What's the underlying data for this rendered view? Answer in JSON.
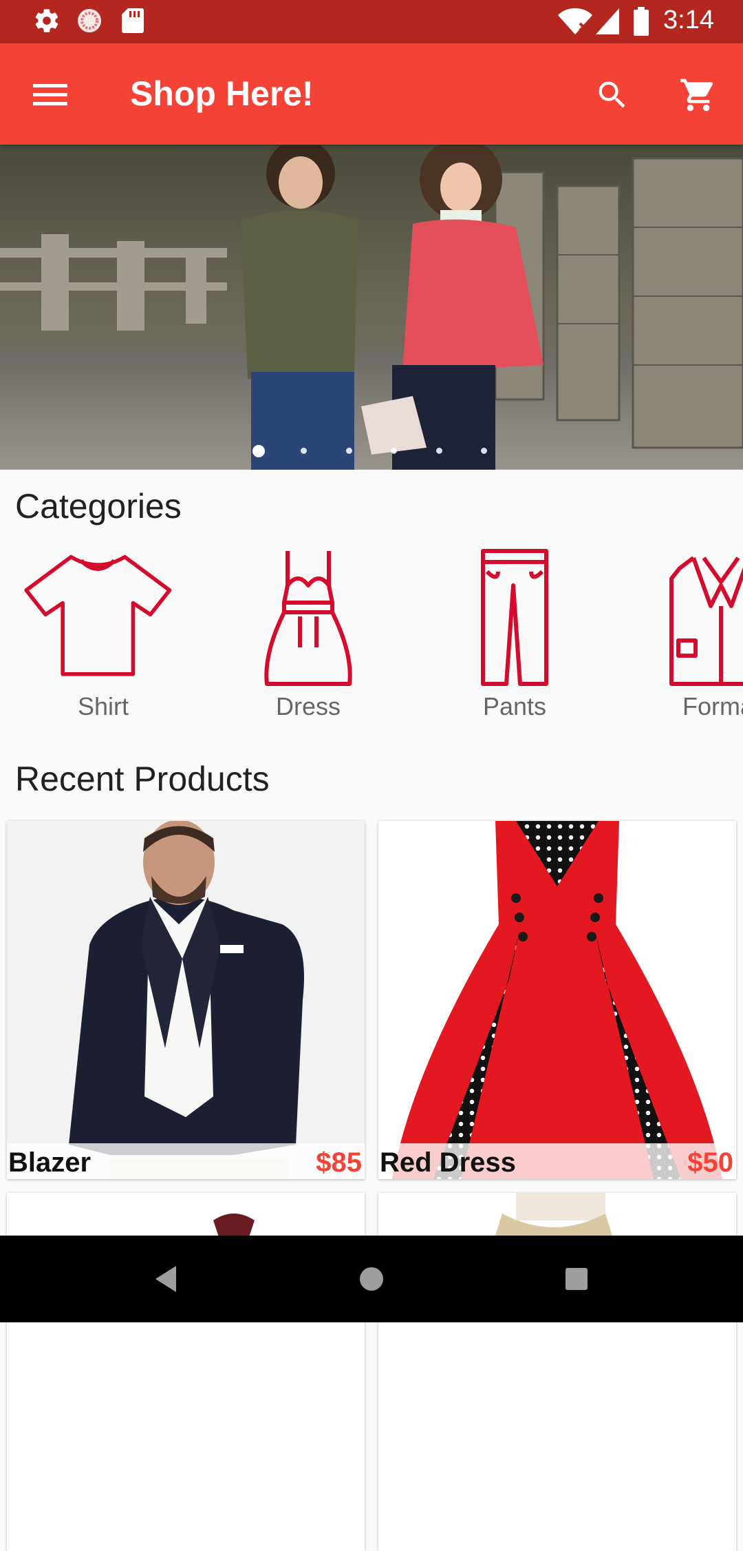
{
  "status_bar": {
    "time": "3:14",
    "icons": [
      "settings-icon",
      "sync-icon",
      "sd-card-icon",
      "wifi-icon",
      "signal-icon",
      "battery-icon"
    ]
  },
  "app_bar": {
    "title": "Shop Here!",
    "icons": [
      "menu-icon",
      "search-icon",
      "cart-icon"
    ],
    "color": "#f44336"
  },
  "banner": {
    "slide_count": 6,
    "active_slide": 1
  },
  "categories": {
    "title": "Categories",
    "items": [
      {
        "label": "Shirt",
        "icon": "shirt-icon"
      },
      {
        "label": "Dress",
        "icon": "dress-icon"
      },
      {
        "label": "Pants",
        "icon": "pants-icon"
      },
      {
        "label": "Formal",
        "icon": "blazer-icon"
      }
    ],
    "icon_color": "#d50b2d"
  },
  "recent_products": {
    "title": "Recent Products",
    "items": [
      {
        "name": "Blazer",
        "price": "$85"
      },
      {
        "name": "Red Dress",
        "price": "$50"
      }
    ],
    "price_color": "#f44336"
  },
  "nav_bar": {
    "icons": [
      "back-icon",
      "home-icon",
      "recents-icon"
    ]
  }
}
